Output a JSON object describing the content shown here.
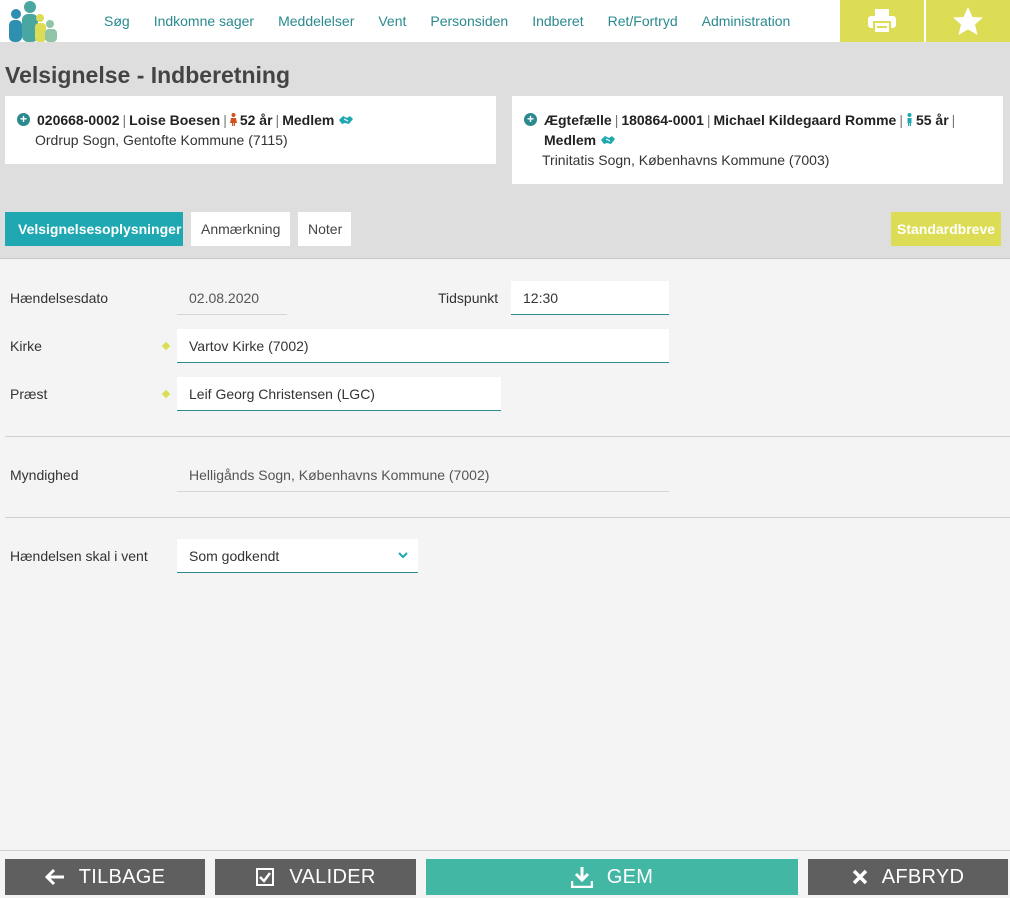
{
  "nav": {
    "items": [
      "Søg",
      "Indkomne sager",
      "Meddelelser",
      "Vent",
      "Personsiden",
      "Indberet",
      "Ret/Fortryd",
      "Administration"
    ]
  },
  "page": {
    "title": "Velsignelse - Indberetning"
  },
  "person1": {
    "cpr": "020668-0002",
    "name": "Loise Boesen",
    "age": "52 år",
    "status": "Medlem",
    "parish": "Ordrup Sogn, Gentofte Kommune (7115)"
  },
  "person2": {
    "role": "Ægtefælle",
    "cpr": "180864-0001",
    "name": "Michael Kildegaard Romme",
    "age": "55 år",
    "status": "Medlem",
    "parish": "Trinitatis Sogn, Københavns Kommune (7003)"
  },
  "tabs": {
    "active": "Velsignelsesoplysninger",
    "remark": "Anmærkning",
    "notes": "Noter",
    "letters": "Standardbreve"
  },
  "form": {
    "event_date_label": "Hændelsesdato",
    "event_date": "02.08.2020",
    "time_label": "Tidspunkt",
    "time": "12:30",
    "church_label": "Kirke",
    "church": "Vartov Kirke (7002)",
    "priest_label": "Præst",
    "priest": "Leif Georg Christensen (LGC)",
    "authority_label": "Myndighed",
    "authority": "Helligånds Sogn, Københavns Kommune (7002)",
    "wait_label": "Hændelsen skal i vent",
    "wait_value": "Som godkendt"
  },
  "buttons": {
    "back": "TILBAGE",
    "validate": "VALIDER",
    "save": "GEM",
    "cancel": "AFBRYD"
  },
  "colors": {
    "teal": "#1fa7b2",
    "link": "#2a8a8f",
    "yellow": "#dcdc55",
    "green": "#42b7a3",
    "dark_button": "#5f5f5f"
  }
}
